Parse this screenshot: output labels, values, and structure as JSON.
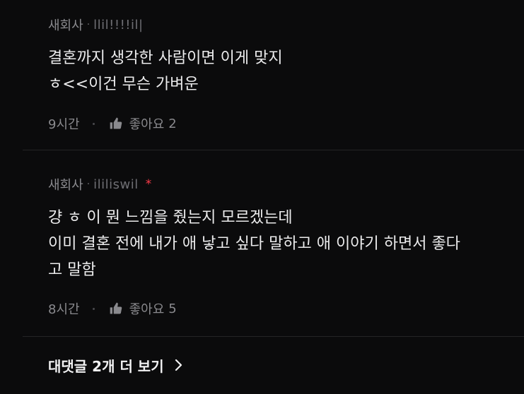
{
  "comments": [
    {
      "company": "새회사",
      "separator": "·",
      "nickname": "llil!!!!il|",
      "has_badge": false,
      "text": "결혼까지 생각한 사람이면 이게 맞지\nㅎ<<이건 무슨 가벼운",
      "time": "9시간",
      "like_label": "좋아요",
      "like_count": "2"
    },
    {
      "company": "새회사",
      "separator": "·",
      "nickname": "ililiswil",
      "badge": "*",
      "text": "걍 ㅎ 이 뭔 느낌을 줬는지 모르겠는데\n이미 결혼 전에 내가 애 낳고 싶다 말하고 애 이야기 하면서 좋다\n고 말함",
      "time": "8시간",
      "like_label": "좋아요",
      "like_count": "5"
    }
  ],
  "more_replies": {
    "label": "대댓글 2개 더 보기",
    "icon": "chevron-right-icon"
  },
  "colors": {
    "background": "#0b0b0c",
    "text": "#ececed",
    "meta": "#8a8a8e",
    "badge": "#ff3b4a"
  }
}
